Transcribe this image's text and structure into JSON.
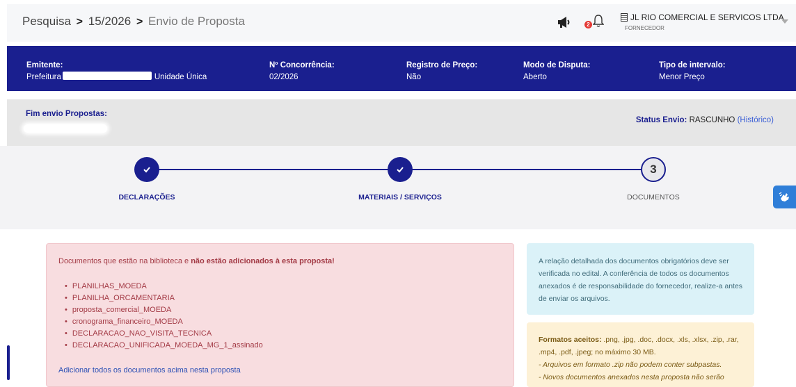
{
  "breadcrumb": {
    "root": "Pesquisa",
    "separator": ">",
    "process": "15/2026",
    "current": "Envio de Proposta"
  },
  "header": {
    "notification_count": "2",
    "company_name": "JL RIO COMERCIAL E SERVICOS LTDA",
    "company_role": "FORNECEDOR",
    "icons": [
      "megaphone-icon",
      "bell-icon",
      "building-icon",
      "chevron-down-icon"
    ]
  },
  "info": {
    "emitente_label": "Emitente:",
    "emitente_prefix": "Prefeitura",
    "emitente_suffix": "Unidade Única",
    "concorrencia_label": "Nº Concorrência:",
    "concorrencia_value": "02/2026",
    "registro_label": "Registro de Preço:",
    "registro_value": "Não",
    "modo_label": "Modo de Disputa:",
    "modo_value": "Aberto",
    "tipo_label": "Tipo de intervalo:",
    "tipo_value": "Menor Preço"
  },
  "status": {
    "fim_label": "Fim envio Propostas:",
    "status_label": "Status Envio:",
    "status_value": "RASCUNHO",
    "historico_open": "(",
    "historico_link": "Histórico",
    "historico_close": ")"
  },
  "steps": [
    {
      "label": "DECLARAÇÕES",
      "state": "done"
    },
    {
      "label": "MATERIAIS / SERVIÇOS",
      "state": "done"
    },
    {
      "label": "DOCUMENTOS",
      "state": "current",
      "number": "3"
    }
  ],
  "colors": {
    "primary": "#1a1f8f",
    "danger_bg": "#f8dde0",
    "info_bg": "#dbf2f8",
    "warning_bg": "#fdf1d6",
    "accessibility": "#2f7ed8"
  },
  "missing_docs": {
    "message_start": "Documentos que estão na biblioteca e ",
    "message_bold": "não estão adicionados à esta proposta!",
    "items": [
      "PLANILHAS_MOEDA",
      "PLANILHA_ORCAMENTARIA",
      "proposta_comercial_MOEDA",
      "cronograma_financeiro_MOEDA",
      "DECLARACAO_NAO_VISITA_TECNICA",
      "DECLARACAO_UNIFICADA_MOEDA_MG_1_assinado"
    ],
    "add_all_link": "Adicionar todos os documentos acima nesta proposta"
  },
  "info_box": {
    "text": "A relação detalhada dos documentos obrigatórios deve ser verificada no edital. A conferência de todos os documentos anexados é de responsabilidade do fornecedor, realize-a antes de enviar os arquivos."
  },
  "formats_box": {
    "label": "Formatos aceitos:",
    "formats": " .png, .jpg, .doc, .docx, .xls, .xlsx, .zip, .rar, .mp4, .pdf, .jpeg; no máximo 30 MB.",
    "note1": "- Arquivos em formato .zip não podem conter subpastas.",
    "note2": "- Novos documentos anexados nesta proposta não serão"
  }
}
